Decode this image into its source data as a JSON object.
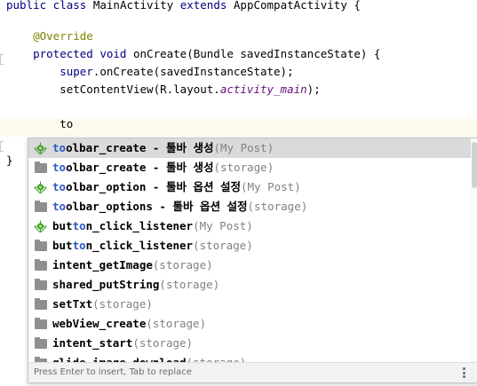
{
  "editor": {
    "lines": [
      {
        "parts": [
          {
            "t": "public class ",
            "c": "kw"
          },
          {
            "t": "MainActivity ",
            "c": ""
          },
          {
            "t": "extends ",
            "c": "kw"
          },
          {
            "t": "AppCompatActivity {",
            "c": ""
          }
        ]
      },
      {
        "parts": [
          {
            "t": "    @Override",
            "c": "ann"
          }
        ]
      },
      {
        "parts": [
          {
            "t": "    protected void ",
            "c": "kw"
          },
          {
            "t": "onCreate(Bundle savedInstanceState) {",
            "c": ""
          }
        ]
      },
      {
        "parts": [
          {
            "t": "        super",
            "c": "kw"
          },
          {
            "t": ".onCreate(savedInstanceState);",
            "c": ""
          }
        ]
      },
      {
        "parts": [
          {
            "t": "        setContentView(R.layout.",
            "c": ""
          },
          {
            "t": "activity_main",
            "c": "fld"
          },
          {
            "t": ");",
            "c": ""
          }
        ]
      },
      {
        "parts": [
          {
            "t": "        to",
            "c": ""
          }
        ]
      },
      {
        "parts": [
          {
            "t": "}",
            "c": ""
          }
        ]
      }
    ]
  },
  "completion": {
    "items": [
      {
        "icon": "snippet",
        "match": "to",
        "rest": "olbar_create - 툴바 생성",
        "hint": "(My Post)"
      },
      {
        "icon": "folder",
        "match": "to",
        "rest": "olbar_create - 툴바 생성",
        "hint": "(storage)"
      },
      {
        "icon": "snippet",
        "match": "to",
        "rest": "olbar_option - 툴바 옵션 설정",
        "hint": "(My Post)"
      },
      {
        "icon": "folder",
        "match": "to",
        "rest": "olbar_options - 툴바 옵션 설정",
        "hint": "(storage)"
      },
      {
        "icon": "snippet",
        "pre": "but",
        "match": "to",
        "rest": "n_click_listener",
        "hint": "(My Post)"
      },
      {
        "icon": "folder",
        "pre": "but",
        "match": "to",
        "rest": "n_click_listener",
        "hint": "(storage)"
      },
      {
        "icon": "folder",
        "rest": "intent_getImage",
        "hint": "(storage)"
      },
      {
        "icon": "folder",
        "rest": "shared_putString",
        "hint": "(storage)"
      },
      {
        "icon": "folder",
        "rest": "setTxt",
        "hint": "(storage)"
      },
      {
        "icon": "folder",
        "rest": "webView_create",
        "hint": "(storage)"
      },
      {
        "icon": "folder",
        "rest": "intent_start",
        "hint": "(storage)"
      },
      {
        "icon": "folder",
        "rest": "glide_image_download",
        "hint": "(storage)"
      }
    ],
    "footer": "Press Enter to insert, Tab to replace",
    "selected_index": 0
  }
}
